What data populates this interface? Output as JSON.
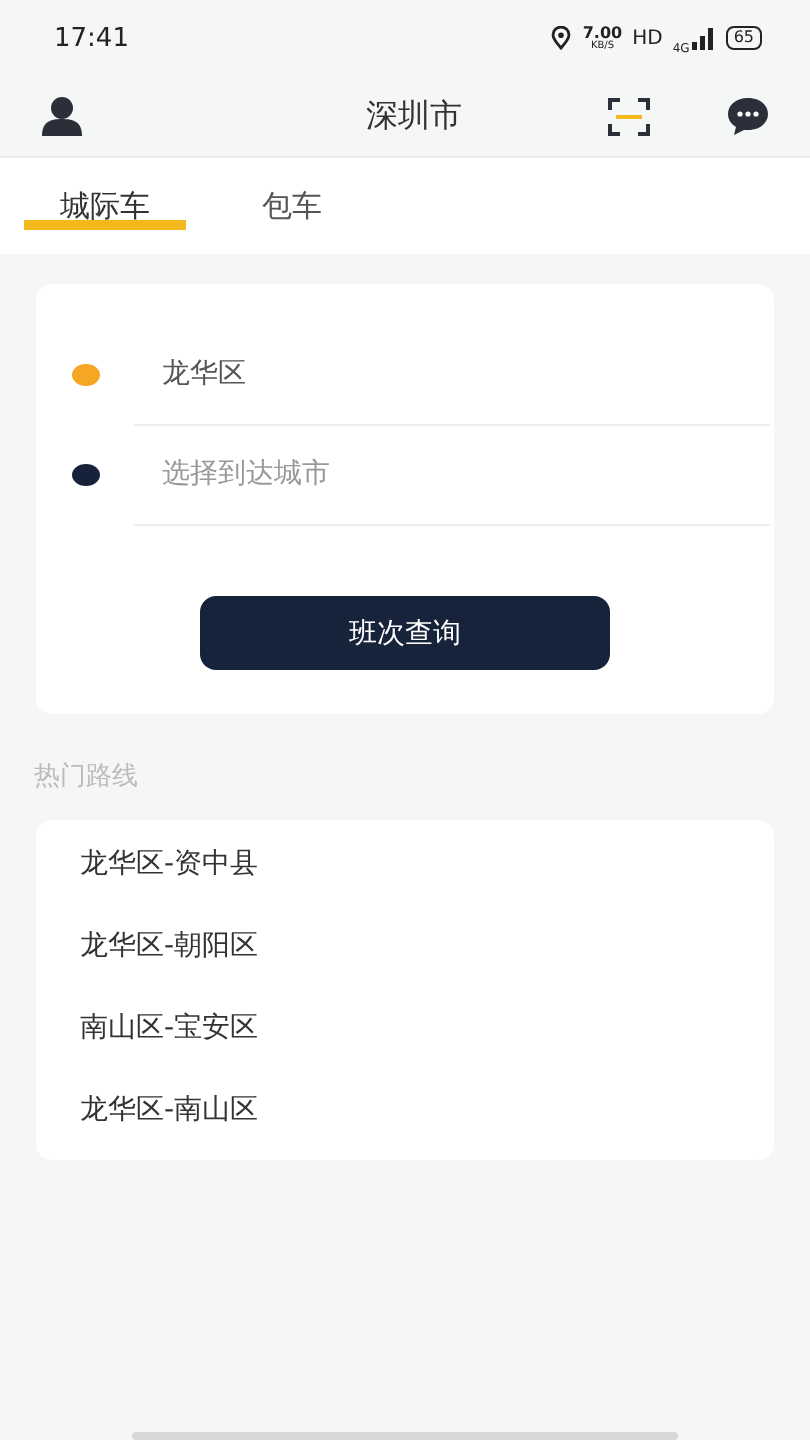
{
  "status_bar": {
    "time": "17:41",
    "speed_value": "7.00",
    "speed_unit": "KB/S",
    "hd": "HD",
    "network": "4G",
    "battery": "65"
  },
  "header": {
    "title": "深圳市"
  },
  "tabs": [
    {
      "label": "城际车",
      "selected": true
    },
    {
      "label": "包车",
      "selected": false
    }
  ],
  "search_form": {
    "fields": [
      {
        "kind": "origin",
        "value": "龙华区",
        "color": "#f5a623"
      },
      {
        "kind": "destination",
        "placeholder": "选择到达城市",
        "color": "#16213a"
      }
    ],
    "button": "班次查询"
  },
  "popular_routes": {
    "title": "热门路线",
    "items": [
      "龙华区-资中县",
      "龙华区-朝阳区",
      "南山区-宝安区",
      "龙华区-南山区"
    ]
  }
}
